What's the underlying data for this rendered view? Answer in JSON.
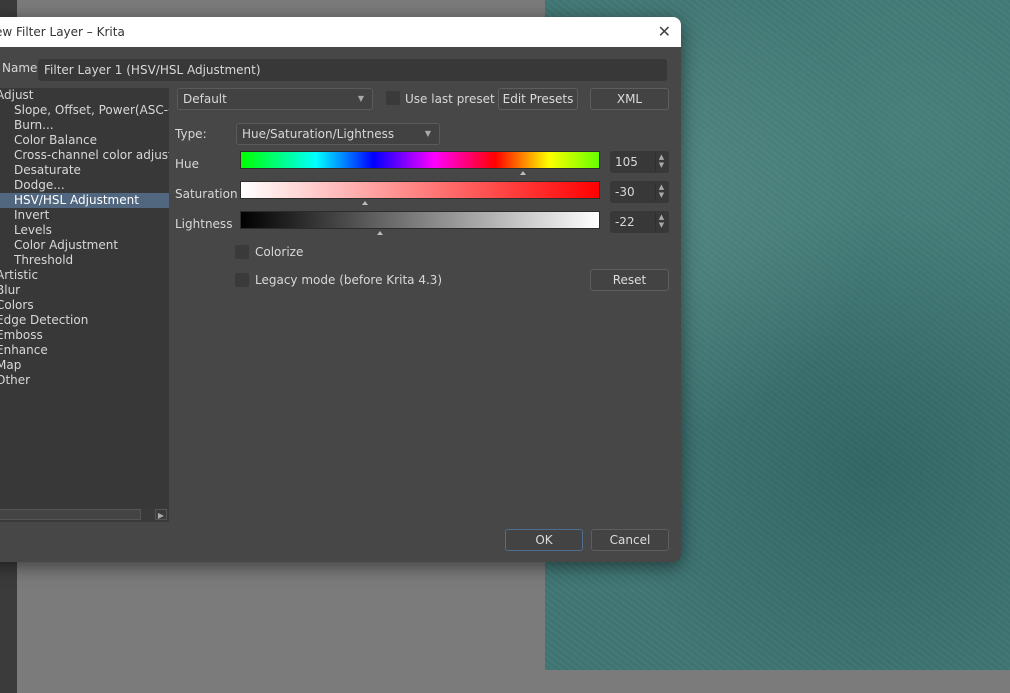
{
  "window": {
    "title": "New Filter Layer – Krita"
  },
  "name": {
    "label": "Name:",
    "value": "Filter Layer 1 (HSV/HSL Adjustment)"
  },
  "tree": {
    "items": [
      {
        "label": "Adjust",
        "level": 0
      },
      {
        "label": "Slope, Offset, Power(ASC-CDL)",
        "level": 1
      },
      {
        "label": "Burn...",
        "level": 1
      },
      {
        "label": "Color Balance",
        "level": 1
      },
      {
        "label": "Cross-channel color adjustment",
        "level": 1
      },
      {
        "label": "Desaturate",
        "level": 1
      },
      {
        "label": "Dodge...",
        "level": 1
      },
      {
        "label": "HSV/HSL Adjustment",
        "level": 1,
        "selected": true
      },
      {
        "label": "Invert",
        "level": 1
      },
      {
        "label": "Levels",
        "level": 1
      },
      {
        "label": "Color Adjustment",
        "level": 1
      },
      {
        "label": "Threshold",
        "level": 1
      },
      {
        "label": "Artistic",
        "level": 0
      },
      {
        "label": "Blur",
        "level": 0
      },
      {
        "label": "Colors",
        "level": 0
      },
      {
        "label": "Edge Detection",
        "level": 0
      },
      {
        "label": "Emboss",
        "level": 0
      },
      {
        "label": "Enhance",
        "level": 0
      },
      {
        "label": "Map",
        "level": 0
      },
      {
        "label": "Other",
        "level": 0
      }
    ]
  },
  "preset": {
    "value": "Default",
    "use_last_preset": "Use last preset",
    "use_last_checked": false,
    "edit_presets": "Edit Presets",
    "xml": "XML"
  },
  "type": {
    "label": "Type:",
    "value": "Hue/Saturation/Lightness"
  },
  "sliders": [
    {
      "label": "Hue",
      "value": "105",
      "min": -180,
      "max": 180
    },
    {
      "label": "Saturation",
      "value": "-30",
      "min": -100,
      "max": 100
    },
    {
      "label": "Lightness",
      "value": "-22",
      "min": -100,
      "max": 100
    }
  ],
  "colorize": {
    "label": "Colorize",
    "checked": false
  },
  "legacy": {
    "label": "Legacy mode (before Krita 4.3)",
    "checked": false
  },
  "buttons": {
    "reset": "Reset",
    "ok": "OK",
    "cancel": "Cancel"
  },
  "colors": {
    "selection": "#50677f",
    "dialog_bg": "#474747",
    "canvas": "#3e7472"
  }
}
